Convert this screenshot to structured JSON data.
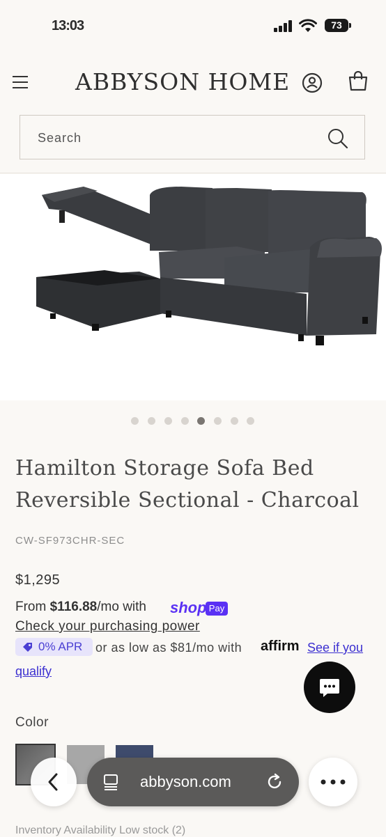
{
  "status_bar": {
    "time": "13:03",
    "battery": "73"
  },
  "header": {
    "logo": "ABBYSON HOME"
  },
  "search": {
    "placeholder": "Search"
  },
  "gallery": {
    "total": 8,
    "active_index": 4
  },
  "product": {
    "title_line1": "Hamilton Storage Sofa Bed",
    "title_line2": "Reversible Sectional - Charcoal",
    "sku": "CW-SF973CHR-SEC",
    "price": "$1,295"
  },
  "financing": {
    "from_prefix": "From ",
    "monthly_amount": "$116.88",
    "monthly_suffix": "/mo with",
    "shop_label": "shop",
    "pay_label": "Pay",
    "purchasing_power_link": "Check your purchasing power",
    "apr_badge": "0% APR",
    "affirm_text": "or as low as $81/mo with",
    "affirm_logo": "affirm",
    "see_if_link": "See if you",
    "qualify_link": "qualify"
  },
  "color": {
    "label": "Color",
    "swatches": [
      "#6e6e6e",
      "#a7a7a7",
      "#3e4b6c"
    ]
  },
  "inventory": "Inventory Availability  Low stock (2)",
  "browser": {
    "url": "abbyson.com"
  },
  "colors": {
    "accent_shop": "#5a31f4",
    "link": "#3b2fd0",
    "apr_bg": "#e7e4fb"
  }
}
